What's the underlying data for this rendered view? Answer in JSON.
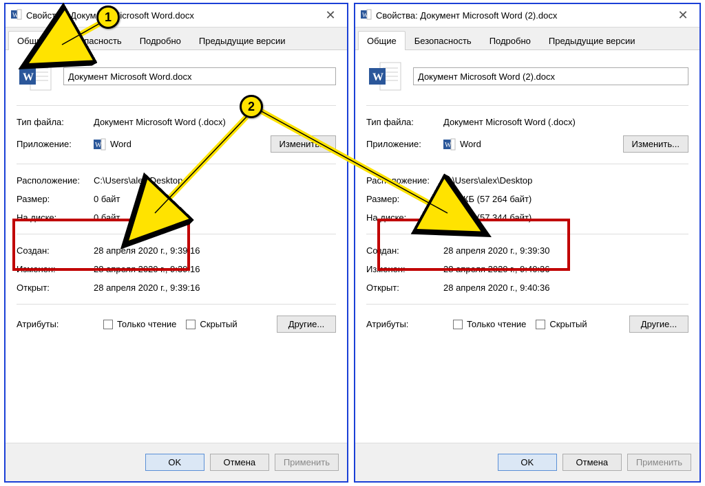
{
  "markers": {
    "one": "1",
    "two": "2"
  },
  "left": {
    "title": "Свойства: Документ Microsoft Word.docx",
    "tabs": [
      "Общие",
      "Безопасность",
      "Подробно",
      "Предыдущие версии"
    ],
    "filename": "Документ Microsoft Word.docx",
    "type_label": "Тип файла:",
    "type_value": "Документ Microsoft Word (.docx)",
    "app_label": "Приложение:",
    "app_value": "Word",
    "change_btn": "Изменить...",
    "loc_label": "Расположение:",
    "loc_value": "C:\\Users\\alex\\Desktop",
    "size_label": "Размер:",
    "size_value": "0 байт",
    "disk_label": "На диске:",
    "disk_value": "0 байт",
    "created_label": "Создан:",
    "created_value": "28 апреля 2020 г., 9:39:16",
    "modified_label": "Изменен:",
    "modified_value": "28 апреля 2020 г., 9:39:16",
    "opened_label": "Открыт:",
    "opened_value": "28 апреля 2020 г., 9:39:16",
    "attrs_label": "Атрибуты:",
    "readonly": "Только чтение",
    "hidden": "Скрытый",
    "other_btn": "Другие...",
    "ok": "OK",
    "cancel": "Отмена",
    "apply": "Применить"
  },
  "right": {
    "title": "Свойства: Документ Microsoft Word (2).docx",
    "tabs": [
      "Общие",
      "Безопасность",
      "Подробно",
      "Предыдущие версии"
    ],
    "filename": "Документ Microsoft Word (2).docx",
    "type_label": "Тип файла:",
    "type_value": "Документ Microsoft Word (.docx)",
    "app_label": "Приложение:",
    "app_value": "Word",
    "change_btn": "Изменить...",
    "loc_label": "Расположение:",
    "loc_value": "C:\\Users\\alex\\Desktop",
    "size_label": "Размер:",
    "size_value": "55,9 КБ (57 264 байт)",
    "disk_label": "На диске:",
    "disk_value": "56,0 КБ (57 344 байт)",
    "created_label": "Создан:",
    "created_value": "28 апреля 2020 г., 9:39:30",
    "modified_label": "Изменен:",
    "modified_value": "28 апреля 2020 г., 9:40:36",
    "opened_label": "Открыт:",
    "opened_value": "28 апреля 2020 г., 9:40:36",
    "attrs_label": "Атрибуты:",
    "readonly": "Только чтение",
    "hidden": "Скрытый",
    "other_btn": "Другие...",
    "ok": "OK",
    "cancel": "Отмена",
    "apply": "Применить"
  }
}
